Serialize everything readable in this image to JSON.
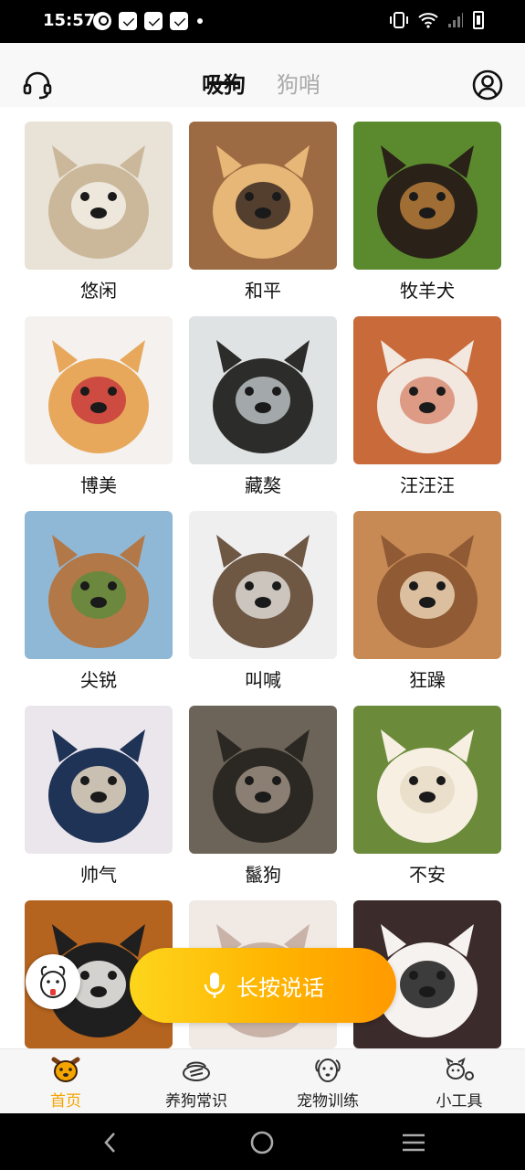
{
  "status_bar": {
    "time": "15:57"
  },
  "header": {
    "tabs": [
      {
        "label": "吸狗",
        "active": true
      },
      {
        "label": "狗哨",
        "active": false
      }
    ]
  },
  "dogs": [
    {
      "label": "悠闲",
      "colors": [
        "#e9e2d7",
        "#cbb89a",
        "#f3efe8"
      ]
    },
    {
      "label": "和平",
      "colors": [
        "#9c6b43",
        "#e7b777",
        "#3a2a22"
      ]
    },
    {
      "label": "牧羊犬",
      "colors": [
        "#5b8a2e",
        "#2a2218",
        "#b57a3a"
      ]
    },
    {
      "label": "博美",
      "colors": [
        "#f4f1ee",
        "#e7a85c",
        "#c83b3b"
      ]
    },
    {
      "label": "藏獒",
      "colors": [
        "#dfe3e4",
        "#2c2c2a",
        "#b9bfc1"
      ]
    },
    {
      "label": "汪汪汪",
      "colors": [
        "#c96a3a",
        "#f2e8df",
        "#d98c75"
      ]
    },
    {
      "label": "尖锐",
      "colors": [
        "#8fb8d7",
        "#b37847",
        "#5f8b3d"
      ]
    },
    {
      "label": "叫喊",
      "colors": [
        "#efefef",
        "#6e5743",
        "#dcd8d2"
      ]
    },
    {
      "label": "狂躁",
      "colors": [
        "#c78a55",
        "#8f5a34",
        "#ead1b2"
      ]
    },
    {
      "label": "帅气",
      "colors": [
        "#ebe6ec",
        "#1f3357",
        "#e7d9c2"
      ]
    },
    {
      "label": "鬣狗",
      "colors": [
        "#6c6459",
        "#2b2722",
        "#9b8f80"
      ]
    },
    {
      "label": "不安",
      "colors": [
        "#6b8b3b",
        "#f6efe2",
        "#e8dcc6"
      ]
    },
    {
      "label": "",
      "colors": [
        "#b4641f",
        "#1f1f1f",
        "#f5f2ee"
      ]
    },
    {
      "label": "",
      "colors": [
        "#f0e9e4",
        "#c9b3a8",
        "#e8dfd8"
      ]
    },
    {
      "label": "",
      "colors": [
        "#3b2b2b",
        "#f6f2ef",
        "#1c1c1c"
      ]
    }
  ],
  "talk_button": {
    "label": "长按说话"
  },
  "bottom_nav": [
    {
      "label": "首页",
      "icon": "dog-face-icon",
      "active": true
    },
    {
      "label": "养狗常识",
      "icon": "dog-food-icon",
      "active": false
    },
    {
      "label": "宠物训练",
      "icon": "dog-head-icon",
      "active": false
    },
    {
      "label": "小工具",
      "icon": "dog-toy-icon",
      "active": false
    }
  ],
  "colors": {
    "accent": "#f6a400",
    "button_start": "#fdd51c",
    "button_end": "#ff9a00"
  }
}
